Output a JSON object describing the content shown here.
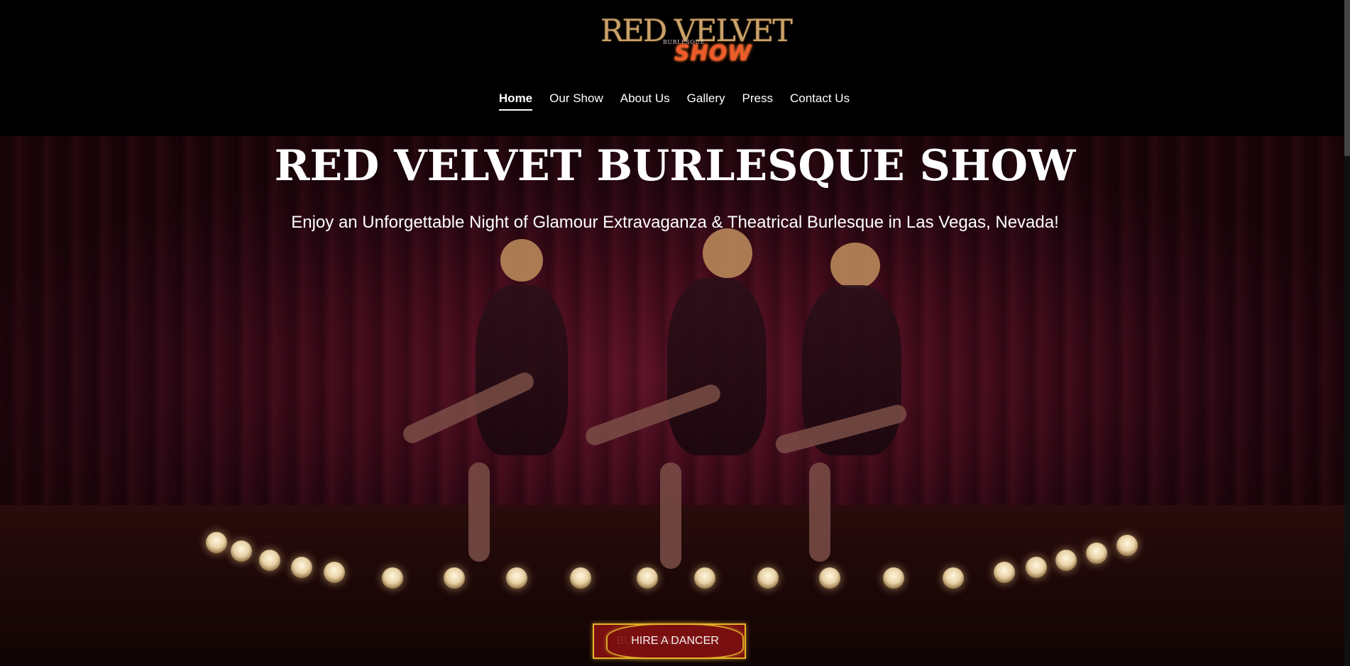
{
  "logo": {
    "line1": "RED VELVET",
    "line2": "BURLESQUE",
    "line3": "SHOW"
  },
  "nav": {
    "items": [
      {
        "label": "Home",
        "active": true
      },
      {
        "label": "Our Show"
      },
      {
        "label": "About Us"
      },
      {
        "label": "Gallery"
      },
      {
        "label": "Press"
      },
      {
        "label": "Contact Us"
      }
    ]
  },
  "hero": {
    "title": "RED VELVET BURLESQUE SHOW",
    "subtitle": "Enjoy an Unforgettable Night of Glamour Extravaganza & Theatrical Burlesque in Las Vegas, Nevada!",
    "buttons": {
      "ticket": "BUY SHOW TICKET",
      "dancer": "HIRE A DANCER"
    }
  },
  "colors": {
    "background": "#000000",
    "button_fill": "#7a0f10",
    "button_border": "#e6b22a",
    "logo_gold": "#caa26a",
    "logo_show": "#f05a2a"
  }
}
